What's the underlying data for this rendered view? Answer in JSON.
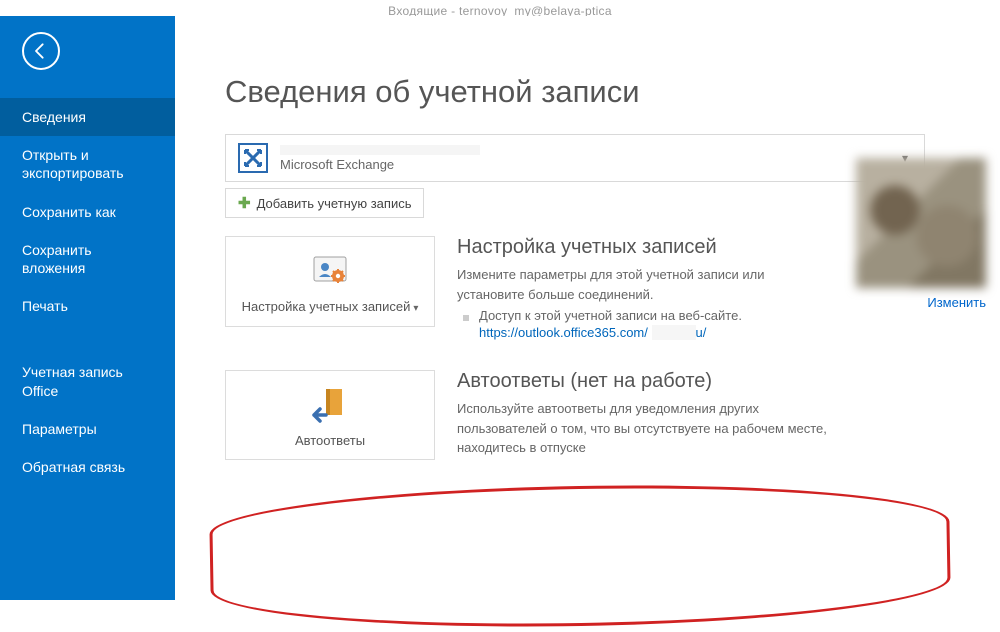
{
  "window_title": "Входящие - ternovoy_my@belaya-ptica",
  "sidebar": {
    "items": [
      "Сведения",
      "Открыть и экспортировать",
      "Сохранить как",
      "Сохранить вложения",
      "Печать",
      "Учетная запись Office",
      "Параметры",
      "Обратная связь"
    ]
  },
  "page_title": "Сведения об учетной записи",
  "account": {
    "service": "Microsoft Exchange",
    "add_button": "Добавить учетную запись"
  },
  "section1": {
    "tile_label": "Настройка учетных записей",
    "heading": "Настройка учетных записей",
    "desc": "Измените параметры для этой учетной записи или установите больше соединений.",
    "bullet": "Доступ к этой учетной записи на веб-сайте.",
    "link_a": "https://outlook.office365.com/",
    "link_b": "u/"
  },
  "avatar_link": "Изменить",
  "section2": {
    "tile_label": "Автоответы",
    "heading": "Автоответы (нет на работе)",
    "desc": "Используйте автоответы для уведомления других пользователей о том, что вы отсутствуете на рабочем месте, находитесь в отпуске"
  }
}
